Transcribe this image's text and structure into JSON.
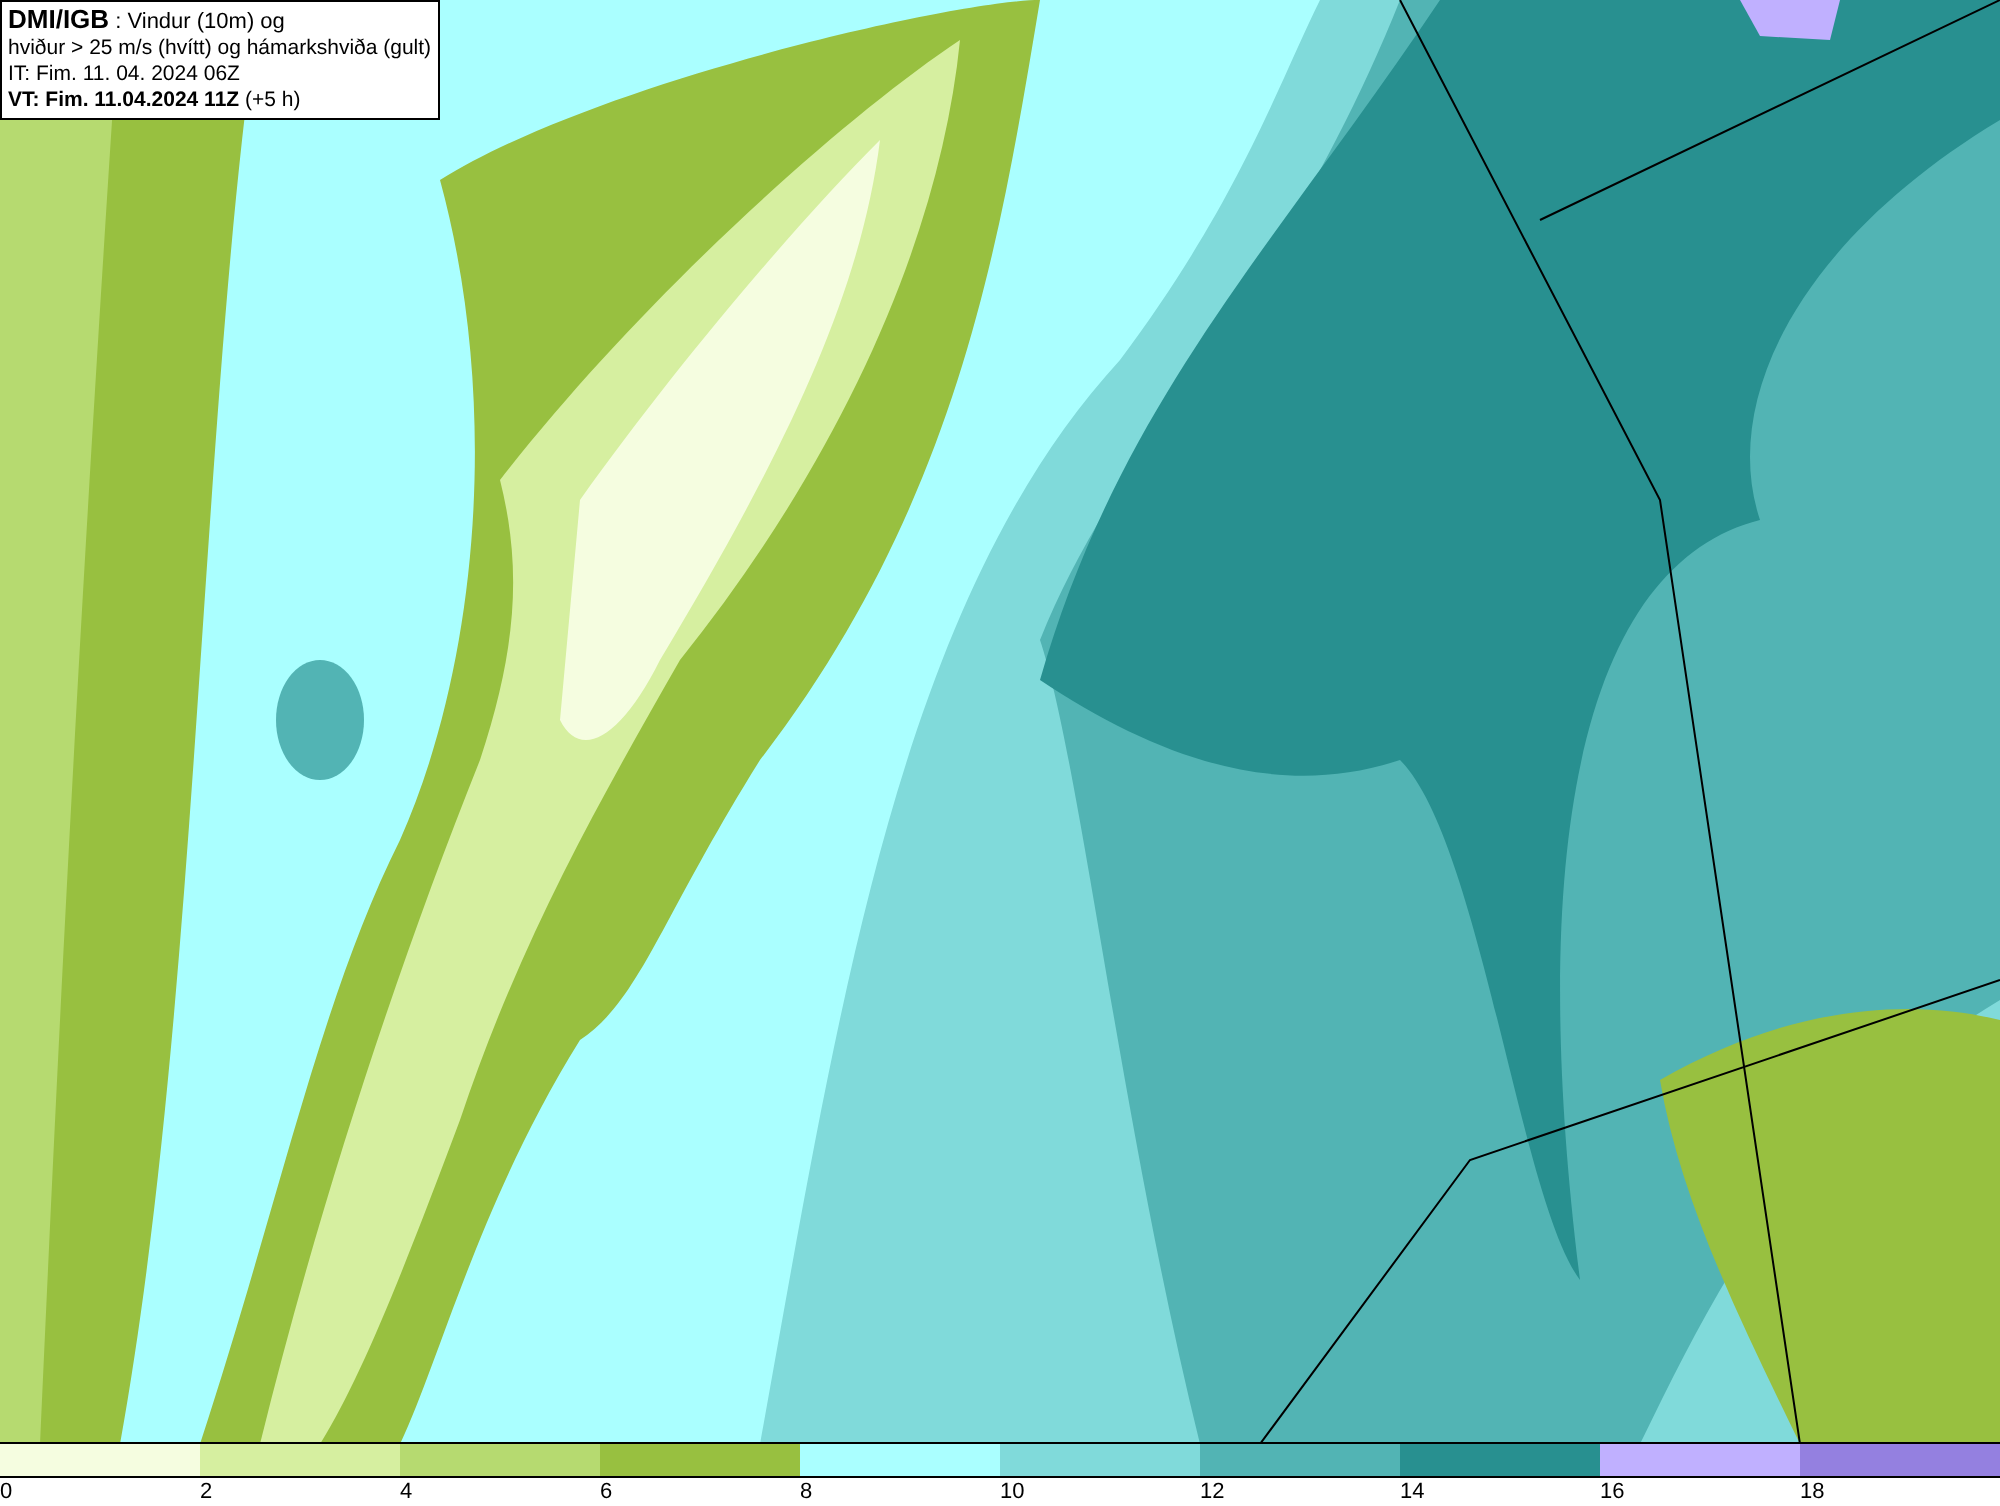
{
  "info_box": {
    "lines": [
      "**DMI/IGB** : Vindur (10m) og",
      "hviður > 25 m/s (hvítt) og hámarkshviða (gult)",
      "IT: Fim. 11. 04. 2024 06Z",
      "**VT: Fim. 11.04.2024 11Z** (+5 h)"
    ]
  },
  "legend": {
    "bins": [
      {
        "label": "0",
        "color": "#f5fde0"
      },
      {
        "label": "2",
        "color": "#d6efa0"
      },
      {
        "label": "4",
        "color": "#b6da70"
      },
      {
        "label": "6",
        "color": "#98c040"
      },
      {
        "label": "8",
        "color": "#aaffff"
      },
      {
        "label": "10",
        "color": "#80dada"
      },
      {
        "label": "12",
        "color": "#52b4b4"
      },
      {
        "label": "14",
        "color": "#289090"
      },
      {
        "label": "16",
        "color": "#c0b0ff"
      },
      {
        "label": "18",
        "color": "#9480e0"
      }
    ]
  }
}
